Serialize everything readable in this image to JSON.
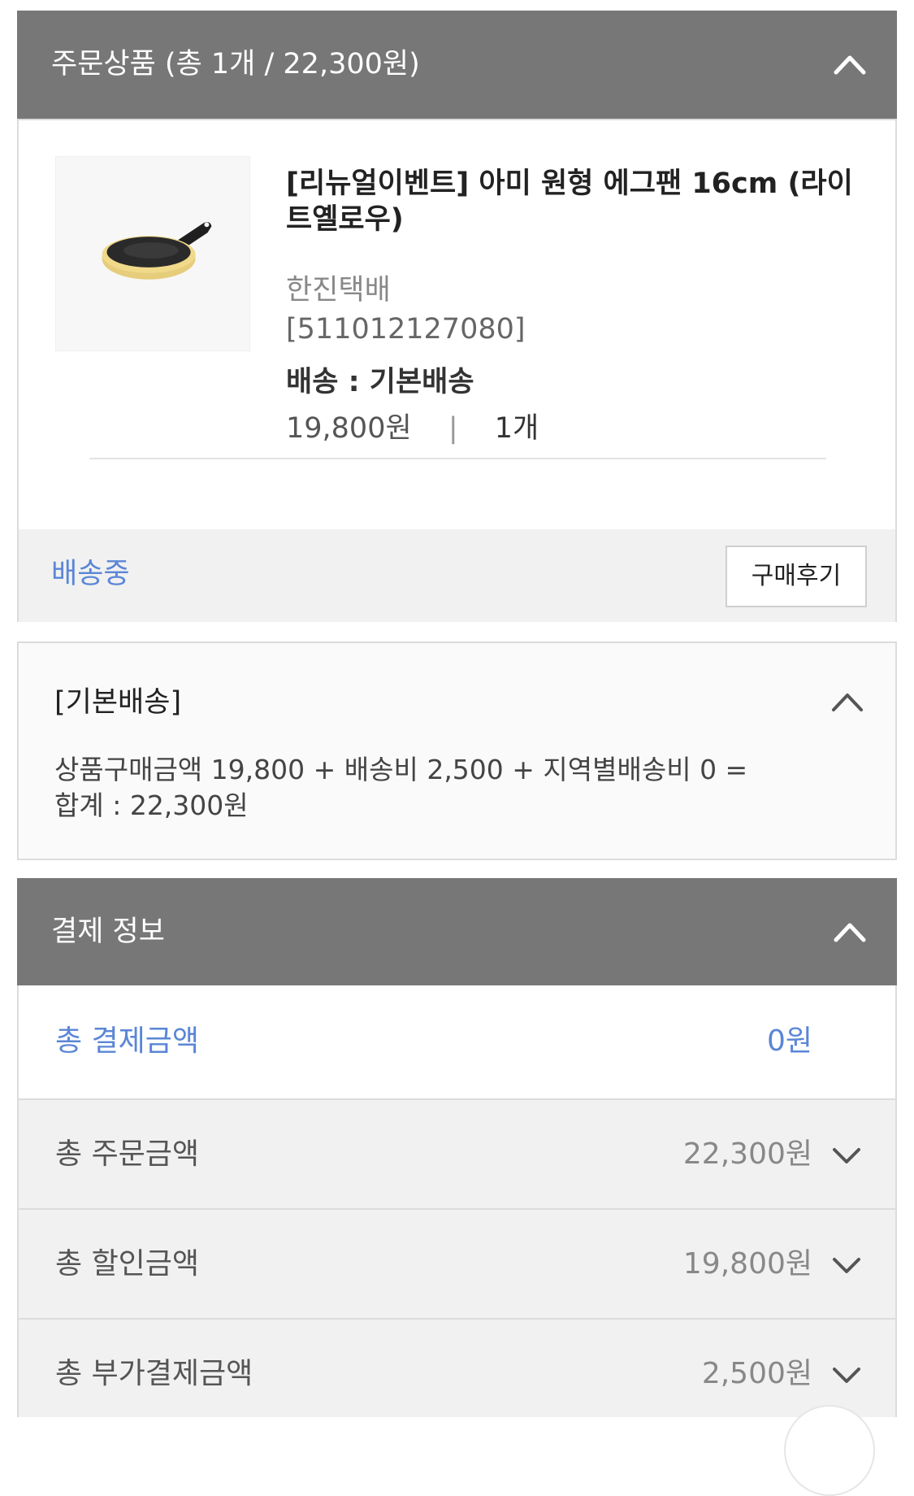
{
  "order_section": {
    "header_title": "주문상품 (총 1개 / 22,300원)",
    "product": {
      "name": "[리뉴얼이벤트] 아미 원형 에그팬 16cm (라이트옐로우)",
      "courier": "한진택배",
      "tracking": "[511012127080]",
      "delivery": "배송 : 기본배송",
      "price": "19,800원",
      "separator": "|",
      "quantity": "1개",
      "image": "yellow-frying-pan"
    },
    "status": "배송중",
    "review_button": "구매후기",
    "shipping": {
      "title": "[기본배송]",
      "calc_line1": "상품구매금액 19,800 + 배송비 2,500 + 지역별배송비 0 =",
      "calc_line2": "합계 : 22,300원"
    }
  },
  "payment_section": {
    "header_title": "결제 정보",
    "total_payment": {
      "label": "총 결제금액",
      "value": "0원"
    },
    "rows": [
      {
        "label": "총 주문금액",
        "value": "22,300원"
      },
      {
        "label": "총 할인금액",
        "value": "19,800원"
      },
      {
        "label": "총 부가결제금액",
        "value": "2,500원"
      }
    ]
  },
  "colors": {
    "header_bg": "#777777",
    "accent_blue": "#5a86d6",
    "row_gray": "#f1f1f1"
  }
}
